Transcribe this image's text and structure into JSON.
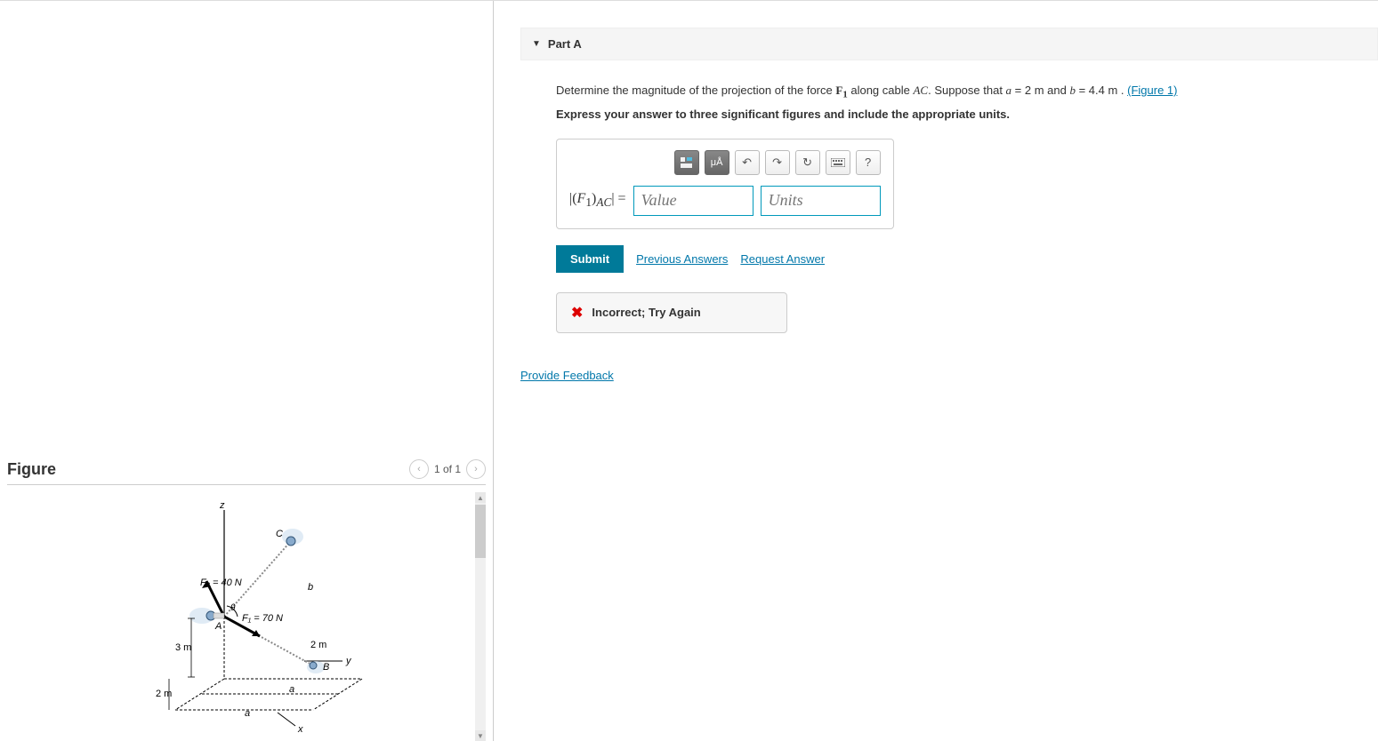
{
  "figure": {
    "title": "Figure",
    "nav_label": "1 of 1",
    "labels": {
      "z": "z",
      "x": "x",
      "y": "y",
      "A": "A",
      "B": "B",
      "C": "C",
      "a1": "a",
      "a2": "a",
      "b": "b",
      "dim_3m": "3 m",
      "dim_2m_left": "2 m",
      "dim_2m_right": "2 m",
      "F2": "F₂ = 40 N",
      "F1": "F₁ = 70 N",
      "theta": "θ"
    }
  },
  "part": {
    "title": "Part A",
    "question_prefix": "Determine the magnitude of the projection of the force ",
    "F1": "F",
    "F1_sub": "1",
    "along": " along cable ",
    "AC": "AC",
    "suppose": ". Suppose that ",
    "a_eq": "a",
    "eq1": " = 2  m and ",
    "b_eq": "b",
    "eq2": " = 4.4  m . ",
    "figure_link": "(Figure 1)",
    "instruction": "Express your answer to three significant figures and include the appropriate units.",
    "answer_label": "|(F₁)ₐᴄ| =",
    "value_placeholder": "Value",
    "units_placeholder": "Units",
    "submit": "Submit",
    "prev_answers": "Previous Answers",
    "request_answer": "Request Answer",
    "feedback": "Incorrect; Try Again",
    "provide_feedback": "Provide Feedback",
    "toolbar": {
      "help": "?"
    }
  }
}
